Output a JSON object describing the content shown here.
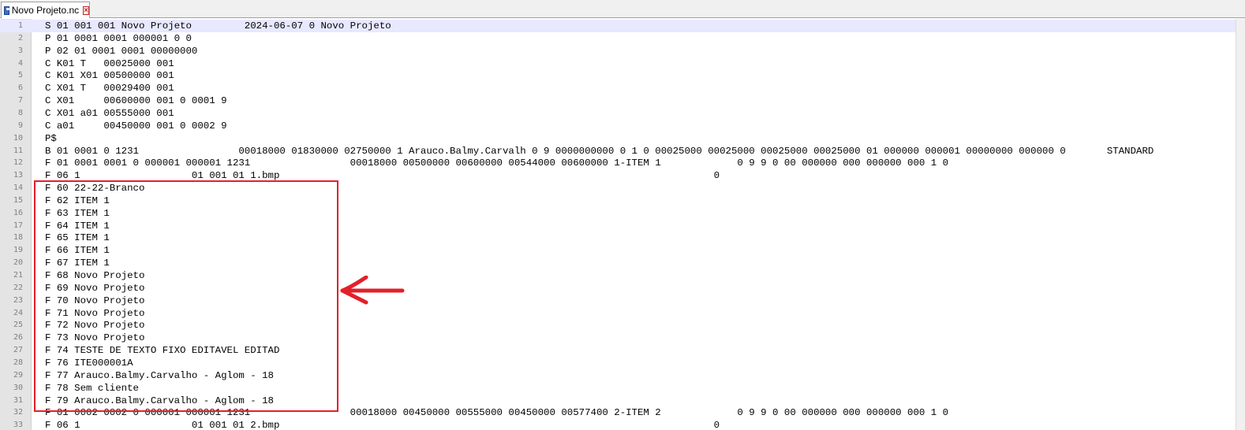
{
  "tab": {
    "title": "Novo Projeto.nc",
    "icon": "save-icon",
    "close_icon": "close-icon"
  },
  "current_line": 1,
  "lines": [
    {
      "n": "1",
      "text": "S 01 001 001 Novo Projeto         2024-06-07 0 Novo Projeto"
    },
    {
      "n": "2",
      "text": "P 01 0001 0001 000001 0 0"
    },
    {
      "n": "3",
      "text": "P 02 01 0001 0001 00000000"
    },
    {
      "n": "4",
      "text": "C K01 T   00025000 001"
    },
    {
      "n": "5",
      "text": "C K01 X01 00500000 001"
    },
    {
      "n": "6",
      "text": "C X01 T   00029400 001"
    },
    {
      "n": "7",
      "text": "C X01     00600000 001 0 0001 9"
    },
    {
      "n": "8",
      "text": "C X01 a01 00555000 001"
    },
    {
      "n": "9",
      "text": "C a01     00450000 001 0 0002 9"
    },
    {
      "n": "10",
      "text": "P$"
    },
    {
      "n": "11",
      "text": "B 01 0001 0 1231                 00018000 01830000 02750000 1 Arauco.Balmy.Carvalh 0 9 0000000000 0 1 0 00025000 00025000 00025000 00025000 01 000000 000001 00000000 000000 0       STANDARD"
    },
    {
      "n": "12",
      "text": "F 01 0001 0001 0 000001 000001 1231                 00018000 00500000 00600000 00544000 00600000 1-ITEM 1             0 9 9 0 00 000000 000 000000 000 1 0"
    },
    {
      "n": "13",
      "text": "F 06 1                   01 001 01 1.bmp                                                                          0"
    },
    {
      "n": "14",
      "text": "F 60 22-22-Branco"
    },
    {
      "n": "15",
      "text": "F 62 ITEM 1"
    },
    {
      "n": "16",
      "text": "F 63 ITEM 1"
    },
    {
      "n": "17",
      "text": "F 64 ITEM 1"
    },
    {
      "n": "18",
      "text": "F 65 ITEM 1"
    },
    {
      "n": "19",
      "text": "F 66 ITEM 1"
    },
    {
      "n": "20",
      "text": "F 67 ITEM 1"
    },
    {
      "n": "21",
      "text": "F 68 Novo Projeto"
    },
    {
      "n": "22",
      "text": "F 69 Novo Projeto"
    },
    {
      "n": "23",
      "text": "F 70 Novo Projeto"
    },
    {
      "n": "24",
      "text": "F 71 Novo Projeto"
    },
    {
      "n": "25",
      "text": "F 72 Novo Projeto"
    },
    {
      "n": "26",
      "text": "F 73 Novo Projeto"
    },
    {
      "n": "27",
      "text": "F 74 TESTE DE TEXTO FIXO EDITAVEL EDITAD"
    },
    {
      "n": "28",
      "text": "F 76 ITE000001A"
    },
    {
      "n": "29",
      "text": "F 77 Arauco.Balmy.Carvalho - Aglom - 18"
    },
    {
      "n": "30",
      "text": "F 78 Sem cliente"
    },
    {
      "n": "31",
      "text": "F 79 Arauco.Balmy.Carvalho - Aglom - 18"
    },
    {
      "n": "32",
      "text": "F 01 0002 0002 0 000001 000001 1231                 00018000 00450000 00555000 00450000 00577400 2-ITEM 2             0 9 9 0 00 000000 000 000000 000 1 0"
    },
    {
      "n": "33",
      "text": "F 06 1                   01 001 01 2.bmp                                                                          0"
    }
  ],
  "annotation": {
    "box_color": "#e3202a",
    "arrow_color": "#e3202a",
    "highlights_lines": "14-31"
  },
  "colors": {
    "current_line_bg": "#e8e8ff",
    "gutter_bg": "#e4e4e4",
    "line_number": "#808080"
  }
}
